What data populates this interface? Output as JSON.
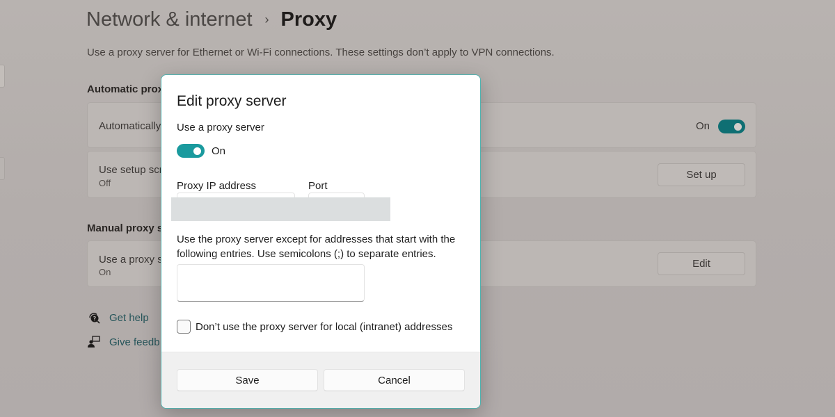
{
  "page": {
    "breadcrumb": {
      "parent": "Network & internet",
      "separator": "›",
      "current": "Proxy"
    },
    "description": "Use a proxy server for Ethernet or Wi-Fi connections. These settings don’t apply to VPN connections.",
    "automatic_section": {
      "title": "Automatic prox",
      "detect_settings": {
        "title": "Automatically",
        "state_label": "On",
        "toggle_on": true
      },
      "setup_script": {
        "title": "Use setup scr",
        "status": "Off",
        "button_label": "Set up"
      }
    },
    "manual_section": {
      "title": "Manual proxy s",
      "use_proxy": {
        "title": "Use a proxy s",
        "status": "On",
        "button_label": "Edit"
      }
    },
    "links": [
      {
        "label": "Get help",
        "icon": "help-icon"
      },
      {
        "label": "Give feedb",
        "icon": "feedback-icon"
      }
    ]
  },
  "dialog": {
    "title": "Edit proxy server",
    "use_proxy_label": "Use a proxy server",
    "toggle_state_label": "On",
    "toggle_on": true,
    "proxy_ip_label": "Proxy IP address",
    "proxy_ip_value": "",
    "port_label": "Port",
    "port_value": "",
    "exceptions_description": "Use the proxy server except for addresses that start with the following entries. Use semicolons (;) to separate entries.",
    "exceptions_value": "",
    "local_checkbox_label": "Don’t use the proxy server for local (intranet) addresses",
    "local_checkbox_checked": false,
    "save_label": "Save",
    "cancel_label": "Cancel"
  },
  "colors": {
    "accent": "#1a9a9e",
    "dialog_border": "#4fb3b0",
    "link": "#26555a"
  }
}
